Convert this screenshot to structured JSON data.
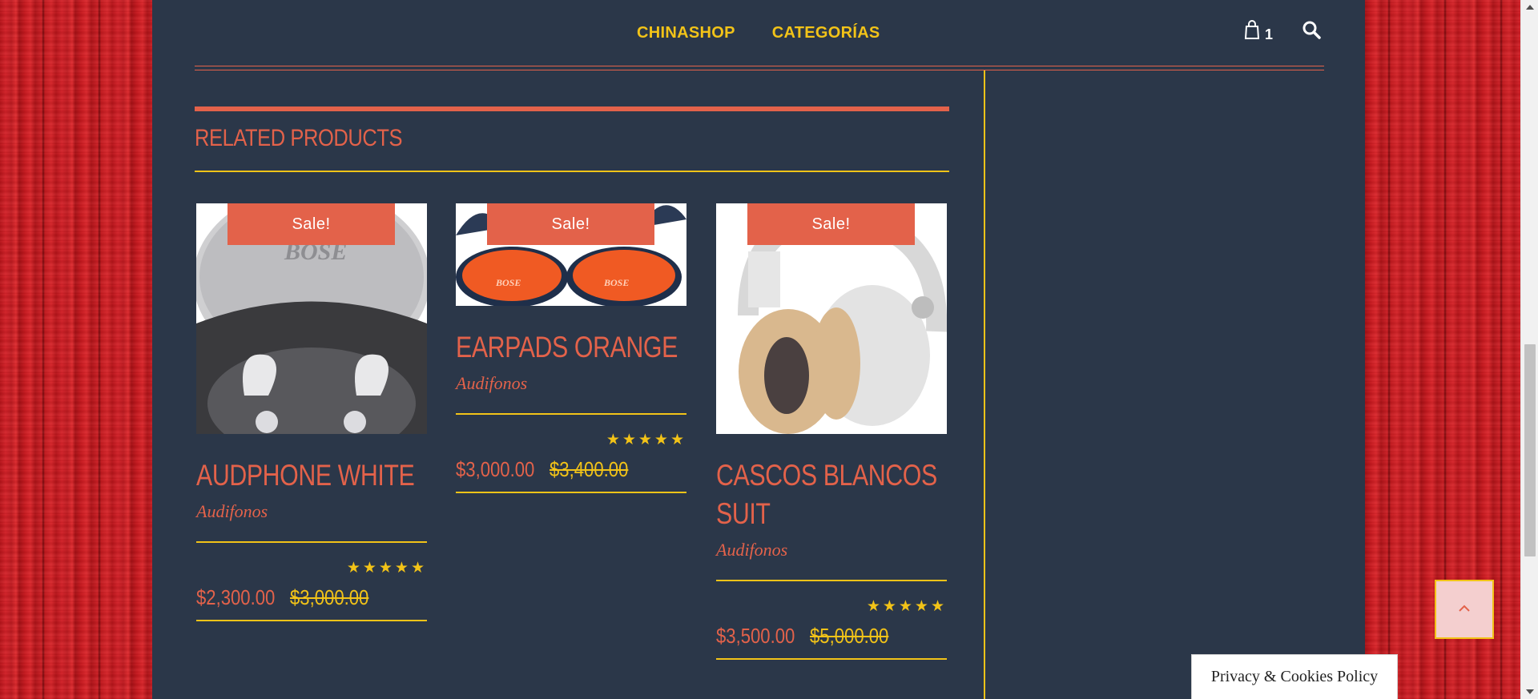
{
  "nav": {
    "items": [
      "CHINASHOP",
      "CATEGORÍAS"
    ]
  },
  "cart": {
    "count": "1",
    "icon": "shopping-bag-icon"
  },
  "search": {
    "icon": "search-icon"
  },
  "related": {
    "title": "RELATED PRODUCTS"
  },
  "products": [
    {
      "sale": "Sale!",
      "name": "AUDPHONE WHITE",
      "category": "Audifonos",
      "stars": "★★★★★",
      "rating": 5,
      "price": "$2,300.00",
      "old_price": "$3,000.00"
    },
    {
      "sale": "Sale!",
      "name": "EARPADS ORANGE",
      "category": "Audifonos",
      "stars": "★★★★★",
      "rating": 5,
      "price": "$3,000.00",
      "old_price": "$3,400.00"
    },
    {
      "sale": "Sale!",
      "name_line1": "CASCOS BLANCOS",
      "name_line2": "SUIT",
      "category": "Audifonos",
      "stars": "★★★★★",
      "rating": 5,
      "price": "$3,500.00",
      "old_price": "$5,000.00"
    }
  ],
  "privacy": {
    "label": "Privacy & Cookies Policy"
  },
  "to_top": {
    "icon": "chevron-up-icon"
  },
  "colors": {
    "accent": "#e3624a",
    "gold": "#f2c318",
    "panel": "#2b3749"
  }
}
